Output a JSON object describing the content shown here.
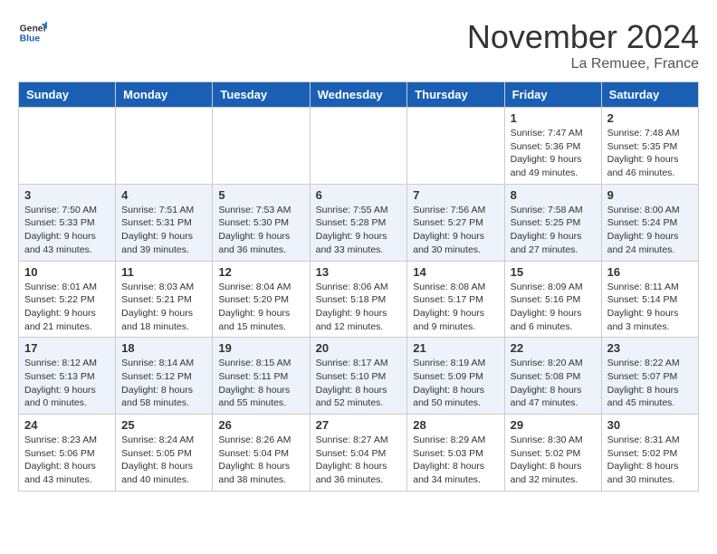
{
  "header": {
    "logo_general": "General",
    "logo_blue": "Blue",
    "month_title": "November 2024",
    "location": "La Remuee, France"
  },
  "weekdays": [
    "Sunday",
    "Monday",
    "Tuesday",
    "Wednesday",
    "Thursday",
    "Friday",
    "Saturday"
  ],
  "weeks": [
    [
      {
        "day": "",
        "info": ""
      },
      {
        "day": "",
        "info": ""
      },
      {
        "day": "",
        "info": ""
      },
      {
        "day": "",
        "info": ""
      },
      {
        "day": "",
        "info": ""
      },
      {
        "day": "1",
        "info": "Sunrise: 7:47 AM\nSunset: 5:36 PM\nDaylight: 9 hours and 49 minutes."
      },
      {
        "day": "2",
        "info": "Sunrise: 7:48 AM\nSunset: 5:35 PM\nDaylight: 9 hours and 46 minutes."
      }
    ],
    [
      {
        "day": "3",
        "info": "Sunrise: 7:50 AM\nSunset: 5:33 PM\nDaylight: 9 hours and 43 minutes."
      },
      {
        "day": "4",
        "info": "Sunrise: 7:51 AM\nSunset: 5:31 PM\nDaylight: 9 hours and 39 minutes."
      },
      {
        "day": "5",
        "info": "Sunrise: 7:53 AM\nSunset: 5:30 PM\nDaylight: 9 hours and 36 minutes."
      },
      {
        "day": "6",
        "info": "Sunrise: 7:55 AM\nSunset: 5:28 PM\nDaylight: 9 hours and 33 minutes."
      },
      {
        "day": "7",
        "info": "Sunrise: 7:56 AM\nSunset: 5:27 PM\nDaylight: 9 hours and 30 minutes."
      },
      {
        "day": "8",
        "info": "Sunrise: 7:58 AM\nSunset: 5:25 PM\nDaylight: 9 hours and 27 minutes."
      },
      {
        "day": "9",
        "info": "Sunrise: 8:00 AM\nSunset: 5:24 PM\nDaylight: 9 hours and 24 minutes."
      }
    ],
    [
      {
        "day": "10",
        "info": "Sunrise: 8:01 AM\nSunset: 5:22 PM\nDaylight: 9 hours and 21 minutes."
      },
      {
        "day": "11",
        "info": "Sunrise: 8:03 AM\nSunset: 5:21 PM\nDaylight: 9 hours and 18 minutes."
      },
      {
        "day": "12",
        "info": "Sunrise: 8:04 AM\nSunset: 5:20 PM\nDaylight: 9 hours and 15 minutes."
      },
      {
        "day": "13",
        "info": "Sunrise: 8:06 AM\nSunset: 5:18 PM\nDaylight: 9 hours and 12 minutes."
      },
      {
        "day": "14",
        "info": "Sunrise: 8:08 AM\nSunset: 5:17 PM\nDaylight: 9 hours and 9 minutes."
      },
      {
        "day": "15",
        "info": "Sunrise: 8:09 AM\nSunset: 5:16 PM\nDaylight: 9 hours and 6 minutes."
      },
      {
        "day": "16",
        "info": "Sunrise: 8:11 AM\nSunset: 5:14 PM\nDaylight: 9 hours and 3 minutes."
      }
    ],
    [
      {
        "day": "17",
        "info": "Sunrise: 8:12 AM\nSunset: 5:13 PM\nDaylight: 9 hours and 0 minutes."
      },
      {
        "day": "18",
        "info": "Sunrise: 8:14 AM\nSunset: 5:12 PM\nDaylight: 8 hours and 58 minutes."
      },
      {
        "day": "19",
        "info": "Sunrise: 8:15 AM\nSunset: 5:11 PM\nDaylight: 8 hours and 55 minutes."
      },
      {
        "day": "20",
        "info": "Sunrise: 8:17 AM\nSunset: 5:10 PM\nDaylight: 8 hours and 52 minutes."
      },
      {
        "day": "21",
        "info": "Sunrise: 8:19 AM\nSunset: 5:09 PM\nDaylight: 8 hours and 50 minutes."
      },
      {
        "day": "22",
        "info": "Sunrise: 8:20 AM\nSunset: 5:08 PM\nDaylight: 8 hours and 47 minutes."
      },
      {
        "day": "23",
        "info": "Sunrise: 8:22 AM\nSunset: 5:07 PM\nDaylight: 8 hours and 45 minutes."
      }
    ],
    [
      {
        "day": "24",
        "info": "Sunrise: 8:23 AM\nSunset: 5:06 PM\nDaylight: 8 hours and 43 minutes."
      },
      {
        "day": "25",
        "info": "Sunrise: 8:24 AM\nSunset: 5:05 PM\nDaylight: 8 hours and 40 minutes."
      },
      {
        "day": "26",
        "info": "Sunrise: 8:26 AM\nSunset: 5:04 PM\nDaylight: 8 hours and 38 minutes."
      },
      {
        "day": "27",
        "info": "Sunrise: 8:27 AM\nSunset: 5:04 PM\nDaylight: 8 hours and 36 minutes."
      },
      {
        "day": "28",
        "info": "Sunrise: 8:29 AM\nSunset: 5:03 PM\nDaylight: 8 hours and 34 minutes."
      },
      {
        "day": "29",
        "info": "Sunrise: 8:30 AM\nSunset: 5:02 PM\nDaylight: 8 hours and 32 minutes."
      },
      {
        "day": "30",
        "info": "Sunrise: 8:31 AM\nSunset: 5:02 PM\nDaylight: 8 hours and 30 minutes."
      }
    ]
  ]
}
